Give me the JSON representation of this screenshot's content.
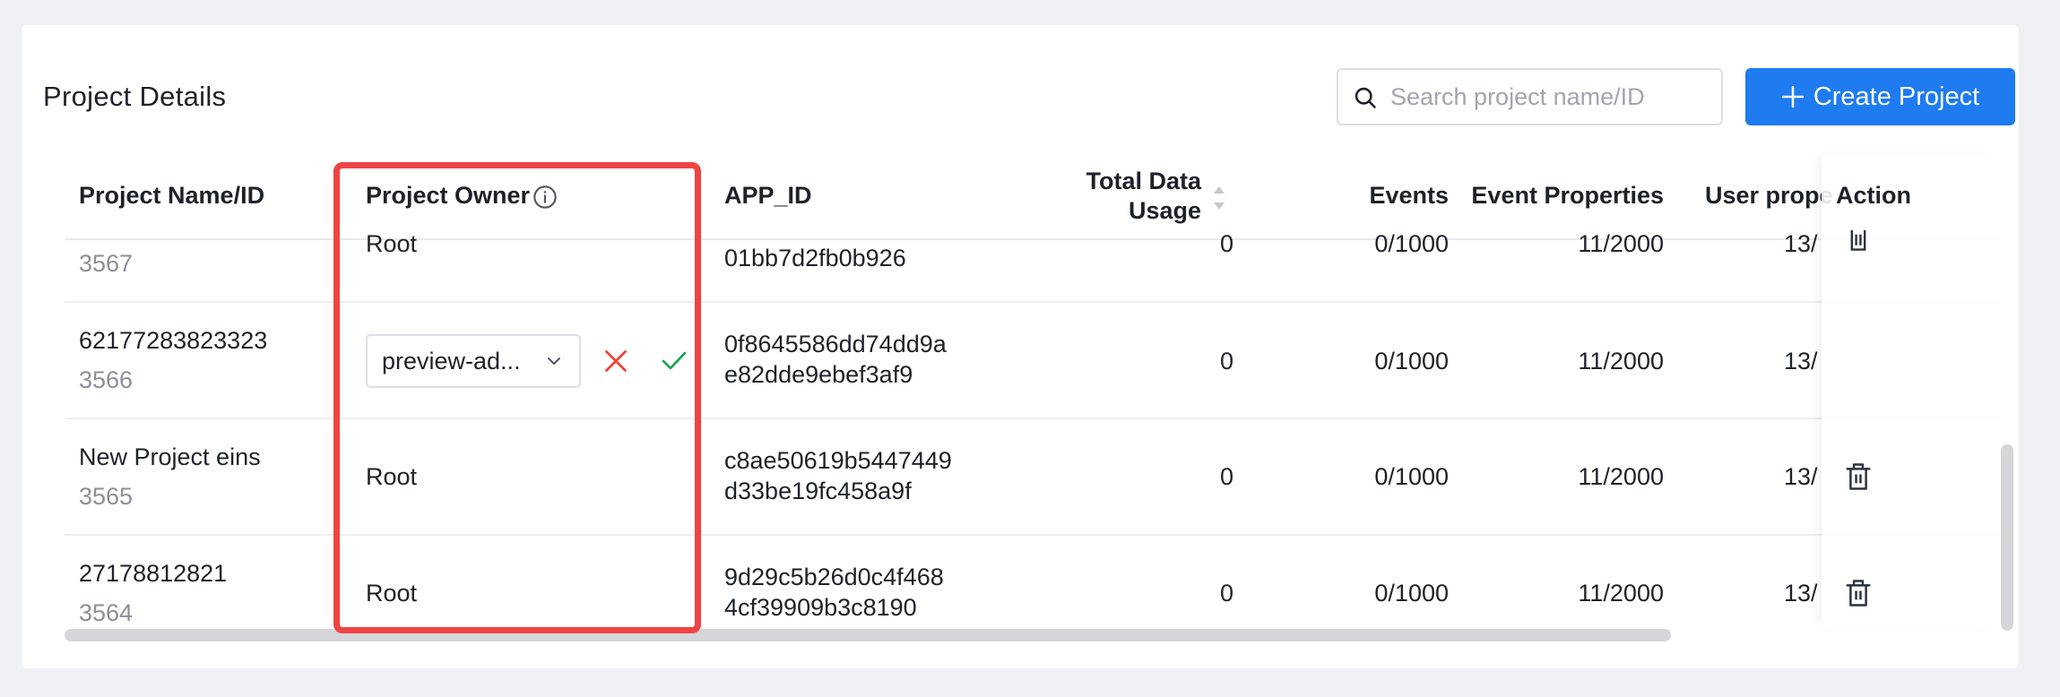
{
  "header": {
    "title": "Project Details",
    "search_placeholder": "Search project name/ID",
    "search_value": "",
    "create_label": "Create Project"
  },
  "table": {
    "columns": {
      "name": "Project Name/ID",
      "owner": "Project Owner",
      "app_id": "APP_ID",
      "usage_line1": "Total Data",
      "usage_line2": "Usage",
      "events": "Events",
      "event_props": "Event Properties",
      "user_props": "User prope",
      "action": "Action"
    },
    "rows": [
      {
        "name": "",
        "id": "3567",
        "owner": "Root",
        "app_id_1": "",
        "app_id_2": "01bb7d2fb0b926",
        "usage": "0",
        "events": "0/1000",
        "event_props": "11/2000",
        "user_props": "13/"
      },
      {
        "name": "62177283823323",
        "id": "3566",
        "owner_select": "preview-ad...",
        "app_id_1": "0f8645586dd74dd9a",
        "app_id_2": "e82dde9ebef3af9",
        "usage": "0",
        "events": "0/1000",
        "event_props": "11/2000",
        "user_props": "13/"
      },
      {
        "name": "New Project eins",
        "id": "3565",
        "owner": "Root",
        "app_id_1": "c8ae50619b5447449",
        "app_id_2": "d33be19fc458a9f",
        "usage": "0",
        "events": "0/1000",
        "event_props": "11/2000",
        "user_props": "13/"
      },
      {
        "name": "27178812821",
        "id": "3564",
        "owner": "Root",
        "app_id_1": "9d29c5b26d0c4f468",
        "app_id_2": "4cf39909b3c8190",
        "usage": "0",
        "events": "0/1000",
        "event_props": "11/2000",
        "user_props": "13/"
      }
    ]
  },
  "icons": {
    "search": "search-icon",
    "plus": "plus-icon",
    "info": "info-icon",
    "sort": "sort-icon",
    "trash": "trash-icon",
    "close": "close-icon",
    "check": "check-icon",
    "chevron": "chevron-down-icon"
  },
  "colors": {
    "primary": "#1e7bf0",
    "highlight": "#ef4444",
    "cancel": "#f04438",
    "confirm": "#16a34a"
  }
}
